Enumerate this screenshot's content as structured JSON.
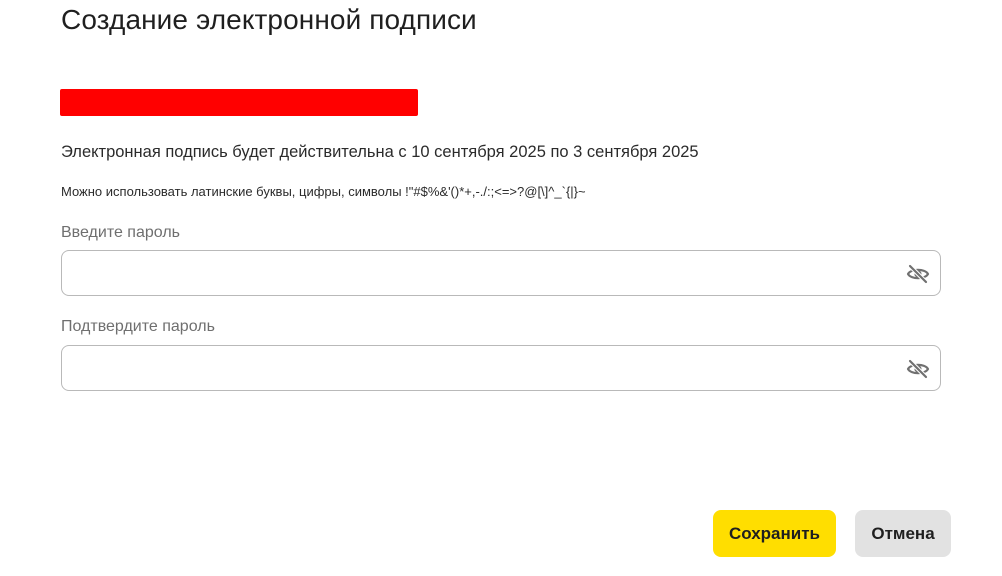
{
  "dialog": {
    "title": "Создание электронной подписи",
    "validity_text": "Электронная подпись будет действительна с 10 сентября 2025 по 3 сентября 2025",
    "password_hint": "Можно использовать латинские буквы, цифры, символы !\"#$%&'()*+,-./:;<=>?@[\\]^_`{|}~"
  },
  "password": {
    "label": "Введите пароль",
    "value": "",
    "toggle_icon": "eye-slash-icon"
  },
  "confirm": {
    "label": "Подтвердите пароль",
    "value": "",
    "toggle_icon": "eye-slash-icon"
  },
  "buttons": {
    "save_label": "Сохранить",
    "cancel_label": "Отмена"
  },
  "colors": {
    "save_bg": "#ffde00",
    "cancel_bg": "#e2e2e2",
    "redaction": "#ff0000"
  }
}
